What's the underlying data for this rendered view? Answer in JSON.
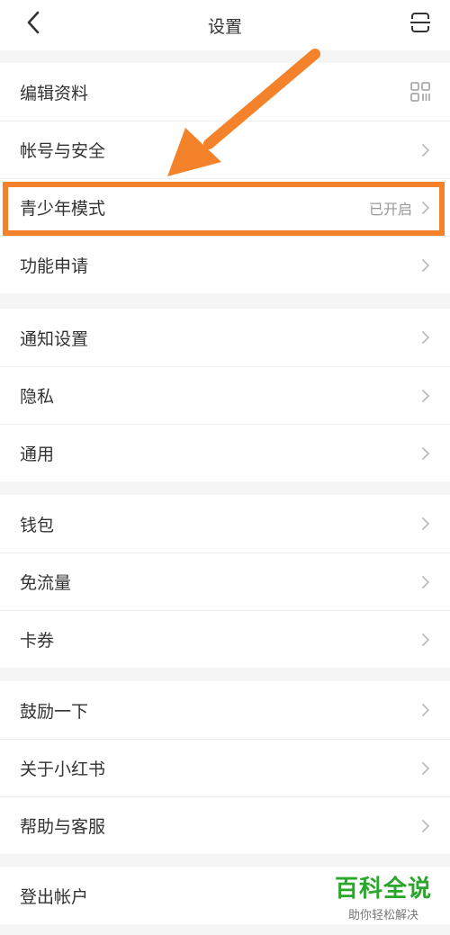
{
  "header": {
    "title": "设置",
    "back_icon": "chevron-left-icon",
    "scan_icon": "scan-icon"
  },
  "groups": [
    {
      "items": [
        {
          "label": "编辑资料",
          "value": "",
          "trailing_icon": "qr-code-icon"
        },
        {
          "label": "帐号与安全",
          "value": "",
          "trailing_icon": "chevron-right-icon"
        },
        {
          "label": "青少年模式",
          "value": "已开启",
          "trailing_icon": "chevron-right-icon"
        },
        {
          "label": "功能申请",
          "value": "",
          "trailing_icon": "chevron-right-icon"
        }
      ]
    },
    {
      "items": [
        {
          "label": "通知设置",
          "value": "",
          "trailing_icon": "chevron-right-icon"
        },
        {
          "label": "隐私",
          "value": "",
          "trailing_icon": "chevron-right-icon"
        },
        {
          "label": "通用",
          "value": "",
          "trailing_icon": "chevron-right-icon"
        }
      ]
    },
    {
      "items": [
        {
          "label": "钱包",
          "value": "",
          "trailing_icon": "chevron-right-icon"
        },
        {
          "label": "免流量",
          "value": "",
          "trailing_icon": "chevron-right-icon"
        },
        {
          "label": "卡券",
          "value": "",
          "trailing_icon": "chevron-right-icon"
        }
      ]
    },
    {
      "items": [
        {
          "label": "鼓励一下",
          "value": "",
          "trailing_icon": "chevron-right-icon"
        },
        {
          "label": "关于小红书",
          "value": "",
          "trailing_icon": "chevron-right-icon"
        },
        {
          "label": "帮助与客服",
          "value": "",
          "trailing_icon": "chevron-right-icon"
        }
      ]
    },
    {
      "items": [
        {
          "label": "登出帐户",
          "value": "",
          "trailing_icon": ""
        }
      ]
    }
  ],
  "annotation": {
    "highlight_color": "#f4822a",
    "arrow_color": "#f4822a"
  },
  "watermark": {
    "main": "百科全说",
    "sub": "助你轻松解决",
    "color": "#2aa62a"
  }
}
